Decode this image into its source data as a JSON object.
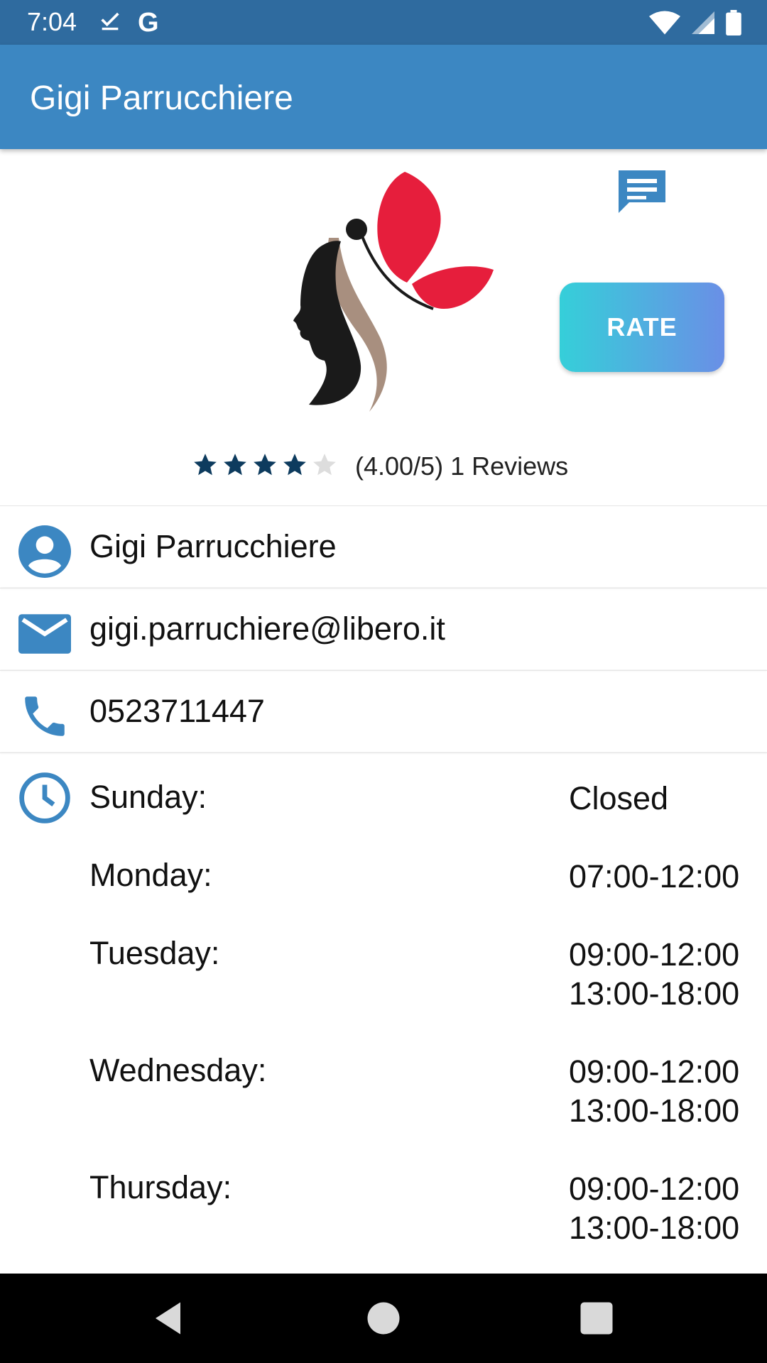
{
  "status_bar": {
    "time": "7:04",
    "left_icons": [
      "download-done-icon",
      "google-icon"
    ],
    "right_icons": [
      "wifi-icon",
      "cell-signal-icon",
      "battery-icon"
    ],
    "google_letter": "G"
  },
  "app_bar": {
    "title": "Gigi Parrucchiere"
  },
  "header": {
    "rate_label": "RATE",
    "rating": {
      "value": 4.0,
      "max": 5,
      "text": "(4.00/5) 1 Reviews"
    }
  },
  "contact": {
    "name": "Gigi Parrucchiere",
    "email": "gigi.parruchiere@libero.it",
    "phone": "0523711447"
  },
  "hours": [
    {
      "day": "Sunday:",
      "times": [
        "Closed"
      ]
    },
    {
      "day": "Monday:",
      "times": [
        "07:00-12:00"
      ]
    },
    {
      "day": "Tuesday:",
      "times": [
        "09:00-12:00",
        "13:00-18:00"
      ]
    },
    {
      "day": "Wednesday:",
      "times": [
        "09:00-12:00",
        "13:00-18:00"
      ]
    },
    {
      "day": "Thursday:",
      "times": [
        "09:00-12:00",
        "13:00-18:00"
      ]
    }
  ],
  "colors": {
    "status_bar": "#2f6b9f",
    "app_bar": "#3c87c2",
    "icon_blue": "#3c87c2",
    "star_filled": "#0d3b5e",
    "star_empty": "#dddddd",
    "logo_red": "#e61e3c",
    "logo_taupe": "#a88f7f"
  }
}
